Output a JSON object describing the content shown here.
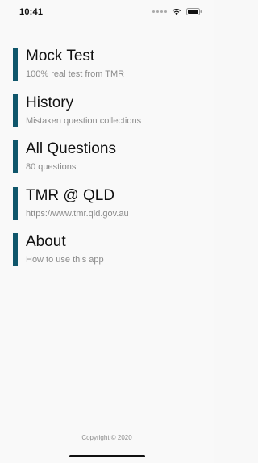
{
  "status_bar": {
    "time": "10:41",
    "icons": [
      "signal-icon",
      "wifi-icon",
      "battery-icon"
    ]
  },
  "menu": {
    "accent_color": "#0f566b",
    "items": [
      {
        "title": "Mock Test",
        "subtitle": "100% real test from TMR"
      },
      {
        "title": "History",
        "subtitle": "Mistaken question collections"
      },
      {
        "title": "All Questions",
        "subtitle": "80 questions"
      },
      {
        "title": "TMR @ QLD",
        "subtitle": "https://www.tmr.qld.gov.au"
      },
      {
        "title": "About",
        "subtitle": "How to use this app"
      }
    ]
  },
  "footer": {
    "copyright": "Copyright © 2020"
  }
}
